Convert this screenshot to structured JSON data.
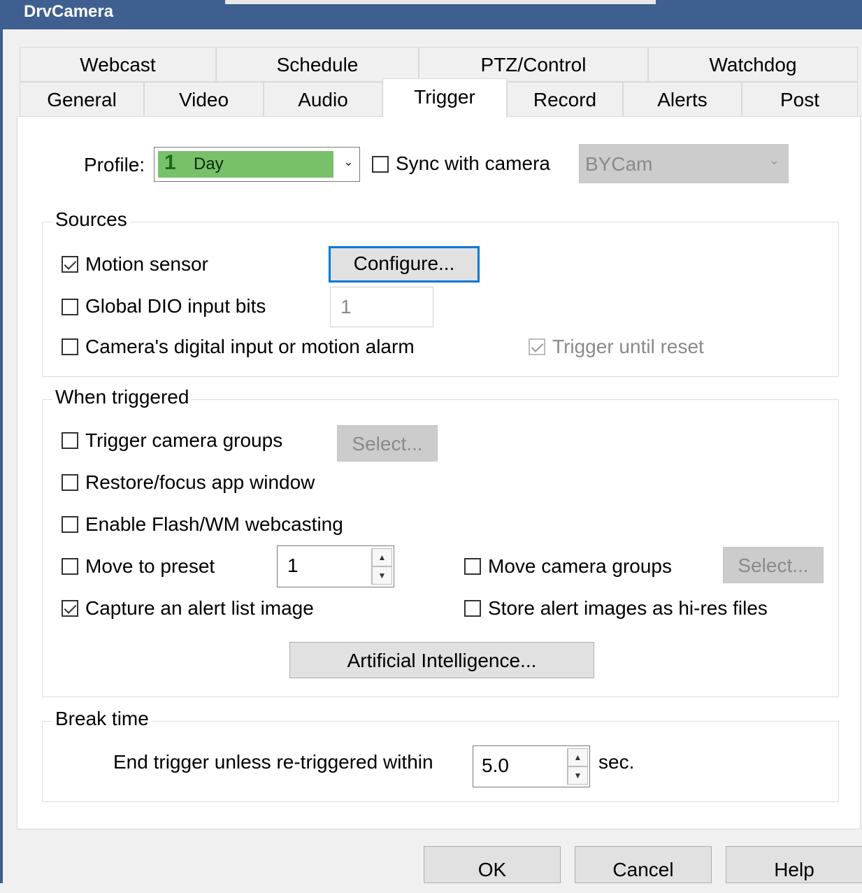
{
  "window": {
    "title": "DrvCamera"
  },
  "tabs_row1": [
    "Webcast",
    "Schedule",
    "PTZ/Control",
    "Watchdog"
  ],
  "tabs_row2": [
    "General",
    "Video",
    "Audio",
    "Trigger",
    "Record",
    "Alerts",
    "Post"
  ],
  "active_tab": "Trigger",
  "profile": {
    "label": "Profile:",
    "number": "1",
    "value": "Day",
    "color": "#78c16a",
    "sync_label": "Sync with camera",
    "sync_checked": false,
    "camera_value": "BYCam"
  },
  "sources": {
    "title": "Sources",
    "motion_sensor": {
      "label": "Motion sensor",
      "checked": true
    },
    "configure_button": "Configure...",
    "dio": {
      "label": "Global DIO input bits",
      "checked": false,
      "value": "1"
    },
    "camera_input": {
      "label": "Camera's digital input or motion alarm",
      "checked": false
    },
    "trigger_until_reset": {
      "label": "Trigger until reset",
      "checked": true,
      "disabled": true
    }
  },
  "when_triggered": {
    "title": "When triggered",
    "trigger_groups": {
      "label": "Trigger camera groups",
      "checked": false
    },
    "select_button_1": "Select...",
    "restore_focus": {
      "label": "Restore/focus app window",
      "checked": false
    },
    "flash_wm": {
      "label": "Enable Flash/WM webcasting",
      "checked": false
    },
    "move_preset": {
      "label": "Move to preset",
      "checked": false,
      "value": "1"
    },
    "move_groups": {
      "label": "Move camera groups",
      "checked": false
    },
    "select_button_2": "Select...",
    "capture_alert": {
      "label": "Capture an alert list image",
      "checked": true
    },
    "store_hires": {
      "label": "Store alert images as hi-res files",
      "checked": false
    },
    "ai_button": "Artificial Intelligence..."
  },
  "break_time": {
    "title": "Break time",
    "label": "End trigger unless re-triggered within",
    "value": "5.0",
    "unit": "sec."
  },
  "footer": {
    "ok": "OK",
    "cancel": "Cancel",
    "help": "Help"
  }
}
